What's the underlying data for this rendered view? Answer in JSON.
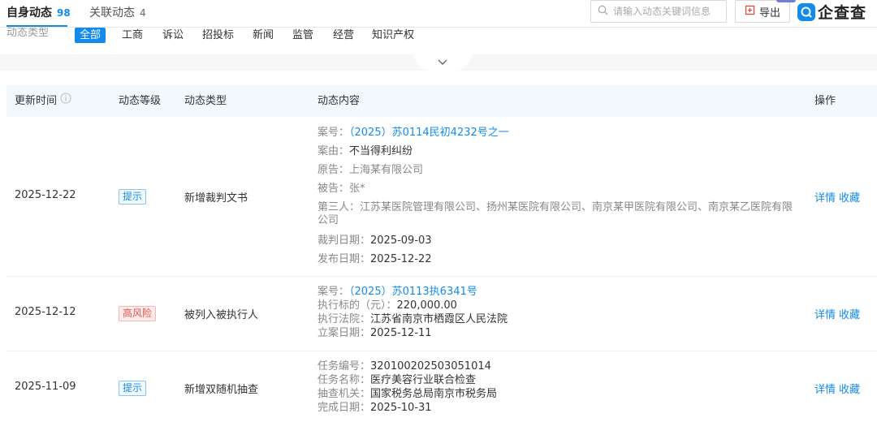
{
  "tabs": {
    "self": {
      "label": "自身动态",
      "count": "98"
    },
    "related": {
      "label": "关联动态",
      "count": "4"
    }
  },
  "search": {
    "placeholder": "请输入动态关键词信息"
  },
  "export": {
    "label": "导出"
  },
  "brand": {
    "name": "企查查"
  },
  "filter": {
    "label": "动态类型",
    "chips": [
      "全部",
      "工商",
      "诉讼",
      "招投标",
      "新闻",
      "监管",
      "经营",
      "知识产权"
    ],
    "selected": "全部"
  },
  "table": {
    "headers": {
      "time": "更新时间",
      "level": "动态等级",
      "type": "动态类型",
      "content": "动态内容",
      "ops": "操作"
    },
    "rows": [
      {
        "date": "2025-12-22",
        "level": "提示",
        "type": "新增裁判文书",
        "details": [
          {
            "k": "案号：",
            "v": "（2025）苏0114民初4232号之一",
            "link": true
          },
          {
            "k": "案由：",
            "v": "不当得利纠纷"
          },
          {
            "k": "原告：",
            "v": "上海某有限公司"
          },
          {
            "k": "被告：",
            "v": "张*"
          },
          {
            "k": "第三人：",
            "v": "江苏某医院管理有限公司、扬州某医院有限公司、南京某甲医院有限公司、南京某乙医院有限公司"
          },
          {
            "k": "裁判日期：",
            "v": "2025-09-03"
          },
          {
            "k": "发布日期：",
            "v": "2025-12-22"
          }
        ],
        "op_detail": "详情",
        "op_favorite": "收藏"
      },
      {
        "date": "2025-12-12",
        "level": "高风险",
        "type": "被列入被执行人",
        "details": [
          {
            "k": "案号：",
            "v": "（2025）苏0113执6341号",
            "link": true
          },
          {
            "k": "执行标的（元）：",
            "v": "220,000.00"
          },
          {
            "k": "执行法院：",
            "v": "江苏省南京市栖霞区人民法院"
          },
          {
            "k": "立案日期：",
            "v": "2025-12-11"
          }
        ],
        "op_detail": "详情",
        "op_favorite": "收藏"
      },
      {
        "date": "2025-11-09",
        "level": "提示",
        "type": "新增双随机抽查",
        "details": [
          {
            "k": "任务编号：",
            "v": "320100202503051014"
          },
          {
            "k": "任务名称：",
            "v": "医疗美容行业联合检查"
          },
          {
            "k": "抽查机关：",
            "v": "国家税务总局南京市税务局"
          },
          {
            "k": "完成日期：",
            "v": "2025-10-31"
          }
        ],
        "op_detail": "详情",
        "op_favorite": "收藏"
      }
    ]
  },
  "colors": {
    "accent": "#128bed",
    "risk": "#e5534b",
    "header_bg": "#f2f9fe"
  }
}
